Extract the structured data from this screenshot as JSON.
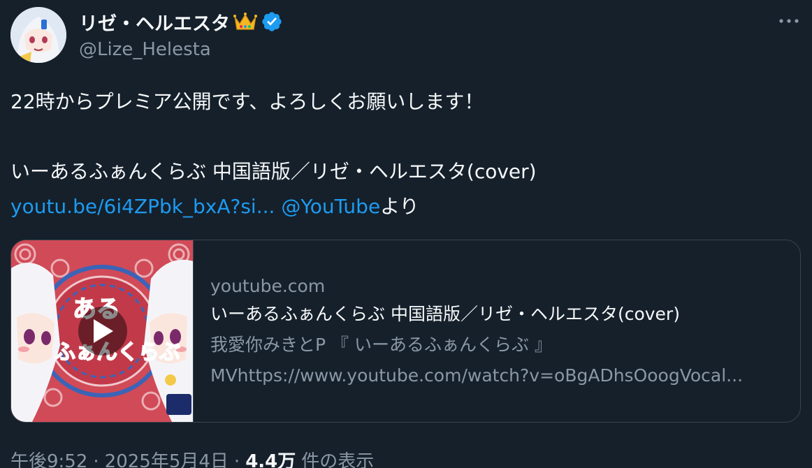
{
  "author": {
    "display_name": "リゼ・ヘルエスタ",
    "handle": "@Lize_Helesta",
    "crown_icon": "crown-emoji",
    "verified_icon": "verified-badge",
    "verified_color": "#1d9bf0"
  },
  "tweet": {
    "line1": "22時からプレミア公開です、よろしくお願いします！",
    "line2": "いーあるふぁんくらぶ 中国語版／リゼ・ヘルエスタ(cover)",
    "link_url_text": "youtu.be/6i4ZPbk_bxA?si...",
    "mention": "@YouTube",
    "suffix": "より"
  },
  "card": {
    "domain": "youtube.com",
    "title": "いーあるふぁんくらぶ 中国語版／リゼ・ヘルエスタ(cover)",
    "desc1": "我愛你みきとP 『 いーあるふぁんくらぶ 』",
    "desc2": "MVhttps://www.youtube.com/watch?v=oBgADhsOoogVocal...",
    "thumb_text": "いーある ふぁんくらぶ",
    "thumb_color": "#d14a57"
  },
  "meta": {
    "time": "午後9:52",
    "date": "2025年5月4日",
    "views_count": "4.4万",
    "views_label": "件の表示",
    "separator": "·"
  }
}
